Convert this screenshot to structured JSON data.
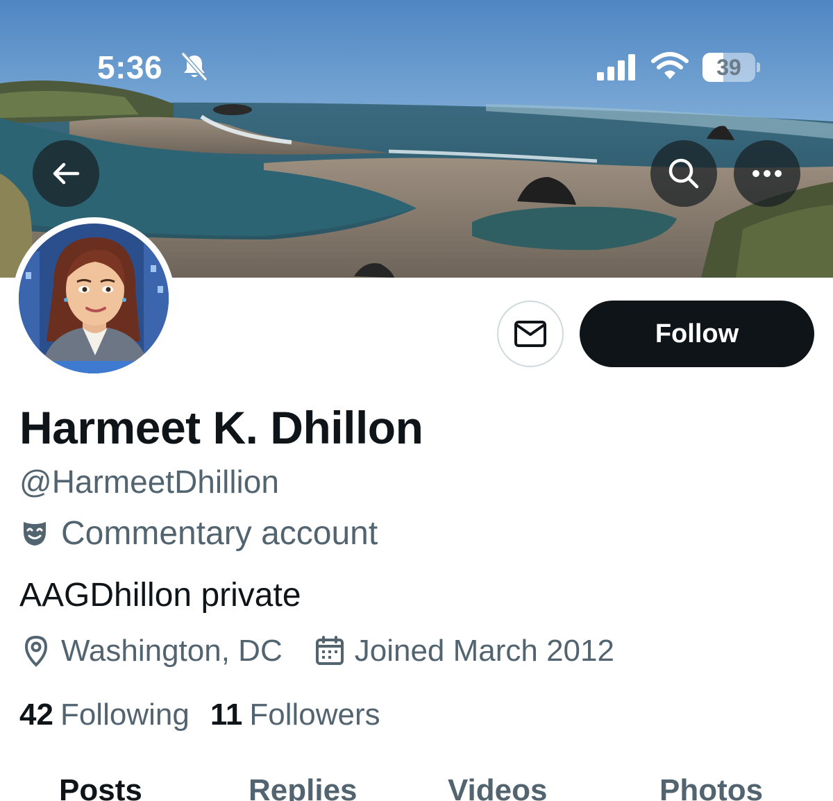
{
  "status_bar": {
    "time": "5:36",
    "battery_percent": 39,
    "battery_label": "39"
  },
  "header": {
    "back_icon": "arrow-left-icon",
    "search_icon": "search-icon",
    "more_icon": "more-horizontal-icon"
  },
  "profile": {
    "display_name": "Harmeet K. Dhillon",
    "handle": "@HarmeetDhillion",
    "label": "Commentary account",
    "bio": "AAGDhillon private",
    "location": "Washington, DC",
    "joined": "Joined March 2012",
    "following_count": "42",
    "following_label": "Following",
    "followers_count": "11",
    "followers_label": "Followers"
  },
  "actions": {
    "message_icon": "envelope-icon",
    "follow_label": "Follow"
  },
  "tabs": [
    {
      "label": "Posts",
      "active": true
    },
    {
      "label": "Replies",
      "active": false
    },
    {
      "label": "Videos",
      "active": false
    },
    {
      "label": "Photos",
      "active": false
    }
  ],
  "colors": {
    "primary_text": "#0f1419",
    "secondary_text": "#536471",
    "follow_bg": "#0f1419",
    "border": "#cfd9de"
  }
}
